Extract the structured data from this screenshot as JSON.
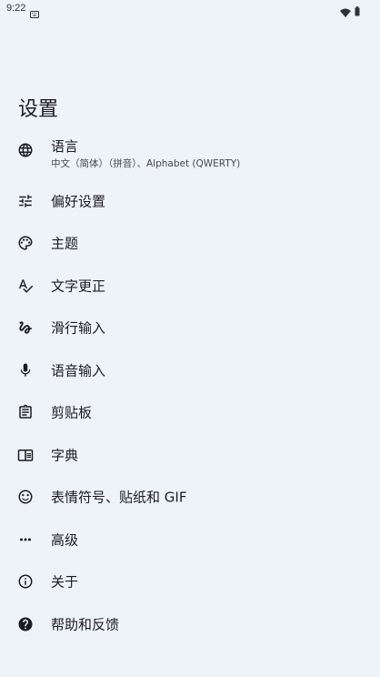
{
  "status_bar": {
    "time": "9:22"
  },
  "page": {
    "title": "设置"
  },
  "items": [
    {
      "label": "语言",
      "sublabel": "中文（简体）（拼音）、Alphabet (QWERTY)",
      "icon": "globe-icon"
    },
    {
      "label": "偏好设置",
      "icon": "tune-icon"
    },
    {
      "label": "主题",
      "icon": "palette-icon"
    },
    {
      "label": "文字更正",
      "icon": "spellcheck-icon"
    },
    {
      "label": "滑行输入",
      "icon": "gesture-icon"
    },
    {
      "label": "语音输入",
      "icon": "mic-icon"
    },
    {
      "label": "剪贴板",
      "icon": "clipboard-icon"
    },
    {
      "label": "字典",
      "icon": "dictionary-icon"
    },
    {
      "label": "表情符号、贴纸和 GIF",
      "icon": "emoji-icon"
    },
    {
      "label": "高级",
      "icon": "more-horiz-icon"
    },
    {
      "label": "关于",
      "icon": "info-icon"
    },
    {
      "label": "帮助和反馈",
      "icon": "help-icon"
    }
  ]
}
